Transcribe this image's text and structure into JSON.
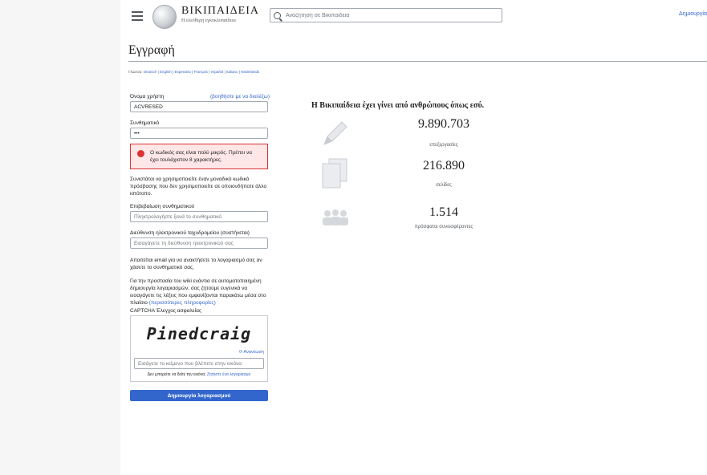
{
  "header": {
    "logo_word": "ΒΙΚΙΠΑΙΔΕΙΑ",
    "logo_tagline": "Η ελεύθερη εγκυκλοπαίδεια",
    "search_placeholder": "Αναζήτηση σε Βικιπαίδεια",
    "create_account_link": "Δημιουργία"
  },
  "page": {
    "title": "Εγγραφή",
    "languages_prefix": "Γλώσσα:",
    "languages": [
      "Deutsch",
      "English",
      "Esperanto",
      "Français",
      "español",
      "Italiano",
      "Nederlands"
    ]
  },
  "form": {
    "username_label": "Όνομα χρήστη",
    "username_help_link": "(βοηθήστε με να διαλέξω)",
    "username_value": "ACVRESED",
    "password_label": "Συνθηματικό",
    "password_value": "•••",
    "error_message": "Ο κωδικός σας είναι πολύ μικρός. Πρέπει να έχει τουλάχιστον 8 χαρακτήρες.",
    "password_advice": "Συνιστάται να χρησιμοποιείτε έναν μοναδικό κωδικό πρόσβασης που δεν χρησιμοποιείτε σε οποιονδήποτε άλλο ιστότοπο.",
    "confirm_label": "Επιβεβαίωση συνθηματικού",
    "confirm_placeholder": "Πληκτρολογήστε ξανά το συνθηματικό",
    "email_label": "Διεύθυνση ηλεκτρονικού ταχυδρομείου (συστήνεται)",
    "email_placeholder": "Εισαγάγετε τη διεύθυνση ηλεκτρονικού σας",
    "email_note": "Απαιτείται email για να ανακτήσετε το λογαριασμό σας αν χάσετε το συνθηματικό σας.",
    "captcha_intro": "Για την προστασία του wiki ενάντια σε αυτοματοποιημένη δημιουργία λογαριασμών, σας ζητούμε ευγενικά να εισαγάγετε τις λέξεις που εμφανίζονται παρακάτω μέσα στο πλαίσιο",
    "captcha_more_link": "(περισσότερες πληροφορίες)",
    "captcha_label": "CAPTCHA Έλεγχος ασφαλείας",
    "captcha_text": "Pinedcraig",
    "captcha_reload": "Ανανέωση",
    "captcha_placeholder": "Εισάγετε το κείμενο που βλέπετε στην εικόνα",
    "captcha_note": "Δεν μπορείτε να δείτε την εικόνα;",
    "captcha_note_link": "Ζητήστε ένα λογαριασμό",
    "submit_label": "Δημιουργία λογαριασμού"
  },
  "stats": {
    "heading": "Η Βικιπαίδεια έχει γίνει από ανθρώπους όπως εσύ.",
    "items": [
      {
        "value": "9.890.703",
        "label": "επεξεργασίες",
        "icon": "pencil-icon"
      },
      {
        "value": "216.890",
        "label": "σελίδες",
        "icon": "pages-icon"
      },
      {
        "value": "1.514",
        "label": "πρόσφατοι συνεισφέροντες",
        "icon": "contributors-icon"
      }
    ]
  },
  "colors": {
    "link": "#3366cc",
    "error_border": "#dd3333",
    "error_bg": "#fee7e6",
    "icon_gray": "#c8ccd1"
  }
}
